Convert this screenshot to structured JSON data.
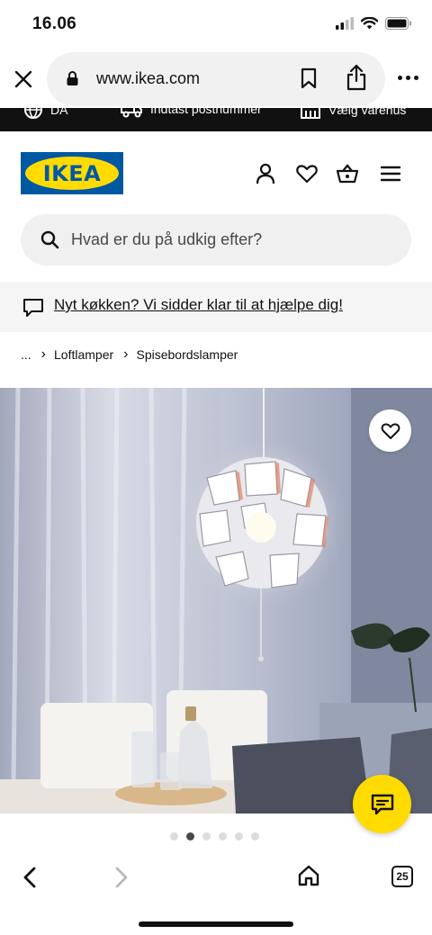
{
  "status": {
    "time": "16.06"
  },
  "browser": {
    "url": "www.ikea.com",
    "tab_count": "25"
  },
  "promo": {
    "items": [
      {
        "icon": "globe-icon",
        "label": "DA"
      },
      {
        "icon": "truck-icon",
        "label": "Indtast postnummer"
      },
      {
        "icon": "store-icon",
        "label": "Vælg varehus"
      }
    ]
  },
  "header": {
    "logo": "IKEA"
  },
  "search": {
    "placeholder": "Hvad er du på udkig efter?"
  },
  "help": {
    "text": "Nyt køkken? Vi sidder klar til at hjælpe dig!"
  },
  "breadcrumb": {
    "ellipsis": "...",
    "items": [
      "Loftlamper",
      "Spisebordslamper"
    ]
  },
  "gallery": {
    "image_count": 6,
    "active_index": 1
  },
  "colors": {
    "ikea_blue": "#0058a3",
    "ikea_yellow": "#ffdb00"
  }
}
